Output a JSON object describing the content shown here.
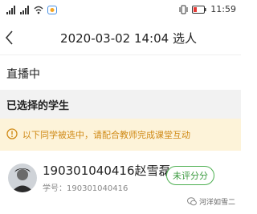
{
  "status_bar": {
    "time": "11:59",
    "icons": [
      "signal-icon",
      "signal-icon",
      "wifi-icon",
      "app-notification-icon",
      "vibrate-icon",
      "battery-icon"
    ],
    "battery_color": "#e53935"
  },
  "nav": {
    "back_icon": "chevron-left-icon",
    "title": "2020-03-02 14:04 选人"
  },
  "live": {
    "label": "直播中"
  },
  "section": {
    "title": "已选择的学生"
  },
  "notice": {
    "icon": "warning-circle-icon",
    "text": "以下同学被选中，请配合教师完成课堂互动",
    "color": "#d08a16"
  },
  "students": [
    {
      "name": "190301040416赵雪磊",
      "id_label": "学号：190301040416",
      "eval_label": "未评分分",
      "accent": "#4caf50"
    }
  ],
  "watermark": {
    "icon": "wechat-icon",
    "text": "河洋如雪二"
  }
}
